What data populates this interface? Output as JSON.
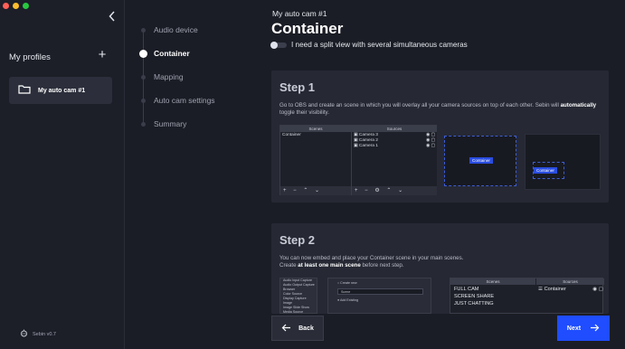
{
  "sidebar": {
    "title": "My profiles",
    "add_label": "+",
    "profiles": [
      {
        "label": "My auto cam #1"
      }
    ],
    "version": "Sebin v0.7"
  },
  "steps": [
    {
      "label": "Audio device",
      "active": false
    },
    {
      "label": "Container",
      "active": true
    },
    {
      "label": "Mapping",
      "active": false
    },
    {
      "label": "Auto cam settings",
      "active": false
    },
    {
      "label": "Summary",
      "active": false
    }
  ],
  "main": {
    "profile_name": "My auto cam #1",
    "title": "Container",
    "toggle_label": "I need a split view with several simultaneous cameras",
    "step1": {
      "title": "Step 1",
      "desc_before": "Go to OBS and create an scene in which you will overlay all your camera sources on top of each other. Sebin will ",
      "desc_bold": "automatically",
      "desc_after": " toggle their visibility.",
      "scenes_header": "Scenes",
      "sources_header": "Sources",
      "scene_item": "Container",
      "sources": [
        "Camera 3",
        "Camera 2",
        "Camera 1"
      ],
      "container_tag": "Container"
    },
    "step2": {
      "title": "Step 2",
      "desc_line1": "You can now embed and place your Container scene in your main scenes.",
      "desc_before": "Create ",
      "desc_bold": "at least one main scene",
      "desc_after": " before next step.",
      "menu_items": [
        "Audio Input Capture",
        "Audio Output Capture",
        "Browser",
        "Color Source",
        "Display Capture",
        "Image",
        "Image Slide Show",
        "Media Source"
      ],
      "create_new": "Create new",
      "field_value": "Scene",
      "add_existing": "Add Existing",
      "scenes_header": "Scenes",
      "sources_header": "Sources",
      "scenes": [
        "FULL CAM",
        "SCREEN SHARE",
        "JUST CHATTING"
      ],
      "source": "Container"
    },
    "back_label": "Back",
    "next_label": "Next"
  },
  "colors": {
    "accent": "#1f4dff",
    "card": "#262934",
    "background": "#1b1d26"
  }
}
